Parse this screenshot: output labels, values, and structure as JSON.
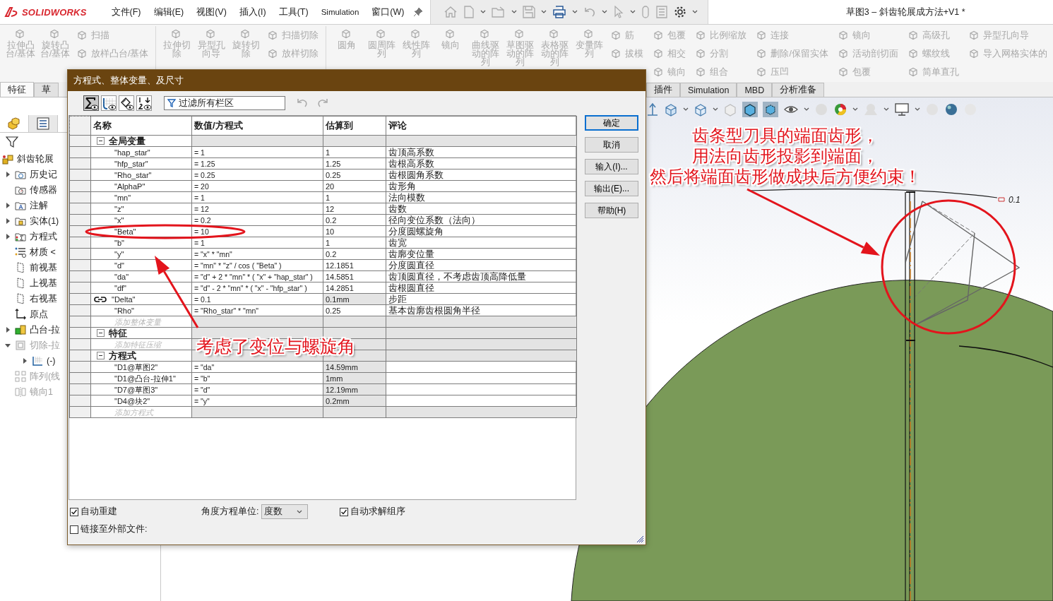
{
  "title_bar": {
    "app_name": "SOLIDWORKS",
    "menus": [
      "文件(F)",
      "编辑(E)",
      "视图(V)",
      "插入(I)",
      "工具(T)",
      "Simulation",
      "窗口(W)"
    ],
    "document_title": "草图3 – 斜齿轮展成方法+V1 *"
  },
  "ribbon": {
    "disabled": true,
    "groups": [
      {
        "large": [
          "拉伸凸台/基体",
          "旋转凸台/基体"
        ],
        "small": [
          [
            "扫描",
            "放样凸台/基体"
          ]
        ]
      },
      {
        "large": [
          "拉伸切除",
          "异型孔向导",
          "旋转切除"
        ],
        "small": [
          [
            "扫描切除",
            "放样切除"
          ]
        ]
      },
      {
        "large": [
          "圆角",
          "圆周阵列",
          "线性阵列",
          "镜向",
          "曲线驱动的阵列",
          "草图驱动的阵列",
          "表格驱动的阵列",
          "变量阵列"
        ],
        "small": [
          [
            "筋",
            "拔模"
          ],
          [
            "包覆",
            "相交",
            "镜向"
          ],
          [
            "比例缩放",
            "分割",
            "组合"
          ],
          [
            "连接",
            "删除/保留实体",
            "压凹"
          ],
          [
            "镜向",
            "活动剖切面",
            "包覆"
          ],
          [
            "高级孔",
            "螺纹线",
            "简单直孔"
          ],
          [
            "异型孔向导",
            "导入网格实体的"
          ]
        ]
      }
    ]
  },
  "command_tabs_left": [
    {
      "label": "特征",
      "selected": true
    },
    {
      "label": "草",
      "selected": false
    }
  ],
  "command_tabs_right": [
    {
      "label": "插件",
      "selected": false
    },
    {
      "label": "Simulation",
      "selected": false
    },
    {
      "label": "MBD",
      "selected": false
    },
    {
      "label": "分析准备",
      "selected": false
    }
  ],
  "panel_tabs": [
    {
      "kind": "feature-manager",
      "selected": true
    },
    {
      "kind": "property-manager",
      "selected": false
    }
  ],
  "feature_tree": [
    {
      "label": "斜齿轮展",
      "kind": "part",
      "expandable": false,
      "suppressed": false,
      "children": [
        {
          "label": "历史记",
          "kind": "history",
          "expandable": true,
          "expanded": false,
          "suppressed": false
        },
        {
          "label": "传感器",
          "kind": "sensor",
          "expandable": false,
          "suppressed": false
        },
        {
          "label": "注解",
          "kind": "annotation",
          "expandable": true,
          "expanded": false,
          "suppressed": false
        },
        {
          "label": "实体(1)",
          "kind": "body",
          "expandable": true,
          "expanded": false,
          "suppressed": false
        },
        {
          "label": "方程式",
          "kind": "equation",
          "expandable": true,
          "expanded": false,
          "suppressed": false
        },
        {
          "label": "材质 <",
          "kind": "material",
          "expandable": false,
          "suppressed": false
        },
        {
          "label": "前视基",
          "kind": "plane",
          "expandable": false,
          "suppressed": false
        },
        {
          "label": "上视基",
          "kind": "plane",
          "expandable": false,
          "suppressed": false
        },
        {
          "label": "右视基",
          "kind": "plane",
          "expandable": false,
          "suppressed": false
        },
        {
          "label": "原点",
          "kind": "origin",
          "expandable": false,
          "suppressed": false
        },
        {
          "label": "凸台-拉",
          "kind": "boss",
          "expandable": true,
          "expanded": false,
          "suppressed": false
        },
        {
          "label": "切除-拉",
          "kind": "cut",
          "expandable": true,
          "expanded": true,
          "suppressed": true,
          "children": [
            {
              "label": "(-)",
              "kind": "sketch",
              "expandable": true,
              "expanded": false,
              "suppressed": false
            }
          ]
        },
        {
          "label": "阵列(线",
          "kind": "pattern",
          "expandable": false,
          "suppressed": true
        },
        {
          "label": "镜向1",
          "kind": "mirror",
          "expandable": false,
          "suppressed": true
        }
      ]
    }
  ],
  "dialog": {
    "title": "方程式、整体变量、及尺寸",
    "view_buttons": [
      {
        "kind": "equation",
        "selected": true
      },
      {
        "kind": "sketch",
        "selected": false
      },
      {
        "kind": "dimension",
        "selected": false
      },
      {
        "kind": "ordered",
        "selected": false
      }
    ],
    "filter": {
      "placeholder": "过滤所有栏区"
    },
    "table": {
      "columns": [
        "名称",
        "数值/方程式",
        "估算到",
        "评论"
      ],
      "sections": [
        {
          "title": "全局变量",
          "expanded": true,
          "add_placeholder": "添加整体变量",
          "rows": [
            {
              "name": "\"hap_star\"",
              "value": "= 1",
              "result": "1",
              "comment": "齿顶高系数",
              "linked": false,
              "shaded": false
            },
            {
              "name": "\"hfp_star\"",
              "value": "= 1.25",
              "result": "1.25",
              "comment": "齿根高系数",
              "linked": false,
              "shaded": false
            },
            {
              "name": "\"Rho_star\"",
              "value": "= 0.25",
              "result": "0.25",
              "comment": "齿根圆角系数",
              "linked": false,
              "shaded": false
            },
            {
              "name": "\"AlphaP\"",
              "value": "= 20",
              "result": "20",
              "comment": "齿形角",
              "linked": false,
              "shaded": false
            },
            {
              "name": "\"mn\"",
              "value": "= 1",
              "result": "1",
              "comment": "法向模数",
              "linked": false,
              "shaded": false
            },
            {
              "name": "\"z\"",
              "value": "= 12",
              "result": "12",
              "comment": "齿数",
              "linked": false,
              "shaded": false
            },
            {
              "name": "\"x\"",
              "value": "= 0.2",
              "result": "0.2",
              "comment": "径向变位系数（法向）",
              "linked": false,
              "shaded": false
            },
            {
              "name": "\"Beta\"",
              "value": "= 10",
              "result": "10",
              "comment": "分度圆螺旋角",
              "linked": false,
              "shaded": false
            },
            {
              "name": "\"b\"",
              "value": "= 1",
              "result": "1",
              "comment": "齿宽",
              "linked": false,
              "shaded": false
            },
            {
              "name": "\"y\"",
              "value": "= \"x\" * \"mn\"",
              "result": "0.2",
              "comment": "齿廓变位量",
              "linked": false,
              "shaded": false
            },
            {
              "name": "\"d\"",
              "value": "= \"mn\" * \"z\" / cos ( \"Beta\" )",
              "result": "12.1851",
              "comment": "分度圆直径",
              "linked": false,
              "shaded": false
            },
            {
              "name": "\"da\"",
              "value": "= \"d\" + 2 * \"mn\" * ( \"x\" + \"hap_star\" )",
              "result": "14.5851",
              "comment": "齿顶圆直径，不考虑齿顶高降低量",
              "linked": false,
              "shaded": false
            },
            {
              "name": "\"df\"",
              "value": "= \"d\" - 2 * \"mn\" * ( \"x\" - \"hfp_star\" )",
              "result": "14.2851",
              "comment": "齿根圆直径",
              "linked": false,
              "shaded": false
            },
            {
              "name": "\"Delta\"",
              "value": "= 0.1",
              "result": "0.1mm",
              "comment": "步距",
              "linked": true,
              "shaded": true
            },
            {
              "name": "\"Rho\"",
              "value": "= \"Rho_star\" * \"mn\"",
              "result": "0.25",
              "comment": "基本齿廓齿根圆角半径",
              "linked": false,
              "shaded": false
            }
          ]
        },
        {
          "title": "特征",
          "expanded": true,
          "add_placeholder": "添加特征压缩"
        },
        {
          "title": "方程式",
          "expanded": true,
          "add_placeholder": "添加方程式",
          "rows": [
            {
              "name": "\"D1@草图2\"",
              "value": "= \"da\"",
              "result": "14.59mm",
              "linked": false,
              "shaded": true
            },
            {
              "name": "\"D1@凸台-拉伸1\"",
              "value": "= \"b\"",
              "result": "1mm",
              "linked": false,
              "shaded": true
            },
            {
              "name": "\"D7@草图3\"",
              "value": "= \"d\"",
              "result": "12.19mm",
              "linked": false,
              "shaded": true
            },
            {
              "name": "\"D4@块2\"",
              "value": "= \"y\"",
              "result": "0.2mm",
              "linked": false,
              "shaded": true
            }
          ]
        }
      ]
    },
    "buttons": [
      {
        "label": "确定",
        "default": true
      },
      {
        "label": "取消",
        "default": false
      },
      {
        "label": "输入(I)...",
        "default": false
      },
      {
        "label": "输出(E)...",
        "default": false
      },
      {
        "label": "帮助(H)",
        "default": false
      }
    ],
    "auto_rebuild": {
      "label": "自动重建",
      "checked": true
    },
    "link_external": {
      "label": "链接至外部文件:",
      "checked": false
    },
    "angle_unit": {
      "label": "角度方程单位:",
      "value": "度数"
    },
    "auto_solve": {
      "label": "自动求解组序",
      "checked": true
    }
  },
  "canvas": {
    "dimension": "0.1"
  },
  "annotations": {
    "callout_lines": [
      "齿条型刀具的端面齿形，",
      "用法向齿形投影到端面，",
      "然后将端面齿形做成块后方便约束！"
    ],
    "table_note": "考虑了变位与螺旋角"
  }
}
